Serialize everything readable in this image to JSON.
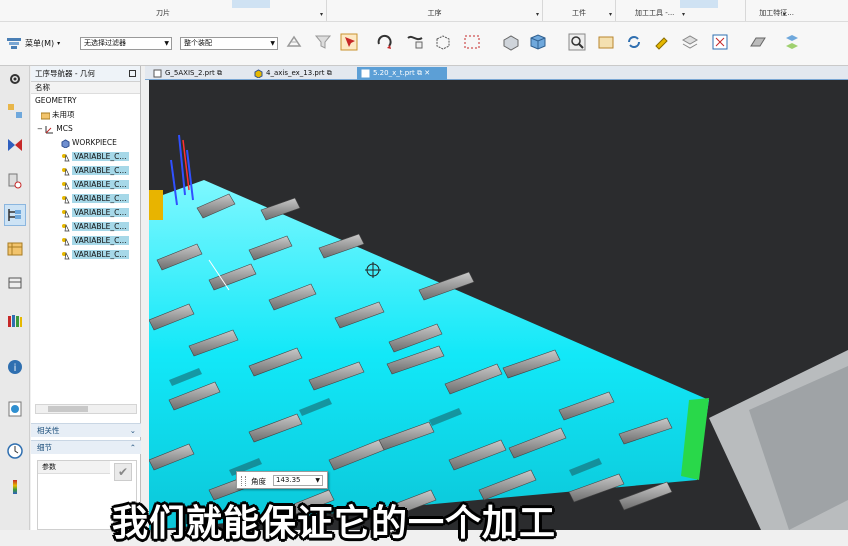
{
  "ribbon": {
    "groups": [
      {
        "label": "刀片",
        "dropdown": true
      },
      {
        "label": "工序",
        "dropdown": true
      },
      {
        "label": "工件",
        "dropdown": true
      },
      {
        "label": "加工工具 -...",
        "dropdown": true
      },
      {
        "label": "加工特征...",
        "dropdown": true
      }
    ]
  },
  "toolbar": {
    "menu_label": "菜单(M)",
    "filter_value": "无选择过滤器",
    "assembly_value": "整个装配",
    "icons": [
      "snap-icon",
      "filter-icon",
      "select-icon",
      "rotate-icon",
      "pattern-icon",
      "box-select-icon",
      "solid-icon",
      "cube-icon",
      "view-fit-icon",
      "view-icon",
      "refresh-icon",
      "paint-icon",
      "layer-icon",
      "grid-icon",
      "surface-icon",
      "display-icon"
    ]
  },
  "side_icons": [
    "settings-icon",
    "assembly-nav-icon",
    "constraint-icon",
    "machine-tool-icon",
    "op-nav-icon",
    "library-icon",
    "part-icon",
    "reuse-icon",
    "info-icon",
    "web-icon",
    "history-icon",
    "analysis-icon"
  ],
  "navigator": {
    "title": "工序导航器 - 几何",
    "column_header": "名称",
    "items": [
      {
        "label": "GEOMETRY",
        "indent": 0,
        "selected": false,
        "icon": "none"
      },
      {
        "label": "未用项",
        "indent": 1,
        "selected": false,
        "icon": "folder-icon"
      },
      {
        "label": "MCS",
        "indent": 1,
        "selected": false,
        "icon": "mcs-icon"
      },
      {
        "label": "WORKPIECE",
        "indent": 2,
        "selected": false,
        "icon": "workpiece-icon"
      },
      {
        "label": "VARIABLE_C...",
        "indent": 2,
        "selected": true,
        "icon": "operation-icon"
      },
      {
        "label": "VARIABLE_C...",
        "indent": 2,
        "selected": true,
        "icon": "operation-icon"
      },
      {
        "label": "VARIABLE_C...",
        "indent": 2,
        "selected": true,
        "icon": "operation-icon"
      },
      {
        "label": "VARIABLE_C...",
        "indent": 2,
        "selected": true,
        "icon": "operation-icon"
      },
      {
        "label": "VARIABLE_C...",
        "indent": 2,
        "selected": true,
        "icon": "operation-icon"
      },
      {
        "label": "VARIABLE_C...",
        "indent": 2,
        "selected": true,
        "icon": "operation-icon"
      },
      {
        "label": "VARIABLE_C...",
        "indent": 2,
        "selected": true,
        "icon": "operation-icon"
      },
      {
        "label": "VARIABLE_C...",
        "indent": 2,
        "selected": true,
        "icon": "operation-icon"
      }
    ],
    "sections": [
      {
        "label": "相关性",
        "collapsed": true
      },
      {
        "label": "细节",
        "collapsed": false
      }
    ],
    "detail_header": "参数"
  },
  "tabs": [
    {
      "label": "G_5AXIS_2.prt",
      "active": false
    },
    {
      "label": "4_axis_ex_13.prt",
      "active": false
    },
    {
      "label": "5.20_x_t.prt",
      "active": true
    }
  ],
  "angle": {
    "label": "角度",
    "value": "143.35"
  },
  "subtitle": "我们就能保证它的一个加工",
  "colors": {
    "accent": "#5c9fd6",
    "toolpath": "#00e5ff",
    "viewport_bg": "#2b2c2e",
    "selection": "#a6d8e8"
  }
}
